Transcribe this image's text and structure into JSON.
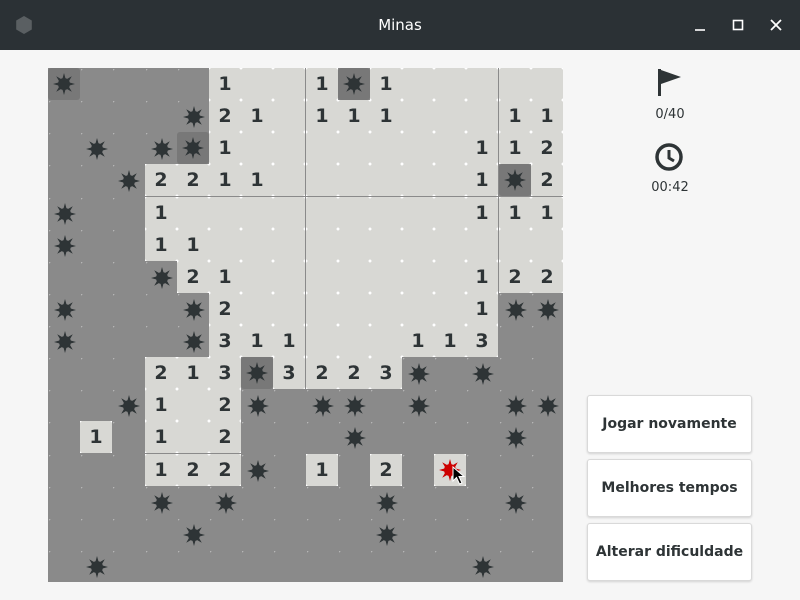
{
  "window": {
    "title": "Minas"
  },
  "status": {
    "flags": "0/40",
    "time": "00:42"
  },
  "buttons": {
    "play_again": "Jogar novamente",
    "best_times": "Melhores tempos",
    "change_difficulty": "Alterar dificuldade"
  },
  "colors": {
    "titlebar": "#2b3135",
    "hidden": "#8a8a8a",
    "open": "#d8d8d4",
    "mine_box": "#787878",
    "number": "#2e3436",
    "exploded": "#cc0000"
  },
  "icons": {
    "flags": "flag-icon",
    "time": "clock-icon",
    "app": "mines-app-icon"
  },
  "board": {
    "cols": 16,
    "rows": 16,
    "legend": "H=hidden, M=hidden mine, B=boxed mine, X=exploded mine, .=open empty, digit=open number",
    "grid": [
      "BHHHH1..1B1.....",
      "HHHHM21.111...11",
      "HMHMB1.......112B",
      "HHM2211......1B21",
      "MHH1.........111.",
      "MHH11...........",
      "HHHM21.......1221",
      "MHHHM2.......1MMH",
      "MHHHM311...113HHH",
      "HHH213B3223MHMHH",
      "HHM1.2MHMMHMHHMM",
      "H1H1.2HHHMHHHHMH",
      "HHH122MH1H2HXHHH",
      "HHHMHMHHHHMHHHMH",
      "HHHHMHHHHHMHHHHH",
      "HMHHHHHHHHHHHMHH"
    ]
  }
}
